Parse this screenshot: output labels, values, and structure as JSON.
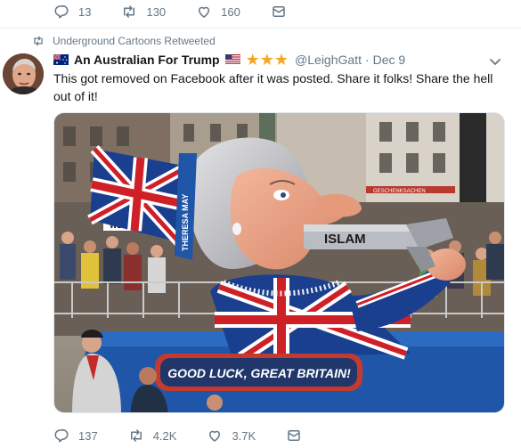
{
  "top_actions": {
    "reply_count": "13",
    "retweet_count": "130",
    "like_count": "160"
  },
  "retweet_header": {
    "text": "Underground Cartoons Retweeted"
  },
  "tweet": {
    "display_name": "An Australian For Trump",
    "stars": "★★★",
    "handle": "@LeighGatt",
    "separator": "·",
    "date": "Dec 9",
    "text": "This got removed on Facebook after it was posted. Share it folks! Share the hell out of it!",
    "media": {
      "gun_label": "ISLAM",
      "banner_text": "GOOD LUCK, GREAT BRITAIN!",
      "hat_text": "THERESA MAY",
      "sign_text": "WDR",
      "store_text": "GESCHENKSACHEN"
    }
  },
  "bottom_actions": {
    "reply_count": "137",
    "retweet_count": "4.2K",
    "like_count": "3.7K"
  },
  "colors": {
    "text_primary": "#14171a",
    "text_secondary": "#657786",
    "divider": "#e6ecf0",
    "star": "#f5a623"
  },
  "icons": [
    "reply-icon",
    "retweet-icon",
    "like-icon",
    "dm-icon",
    "australia-flag-icon",
    "us-flag-icon",
    "star-icon",
    "caret-down-icon"
  ]
}
